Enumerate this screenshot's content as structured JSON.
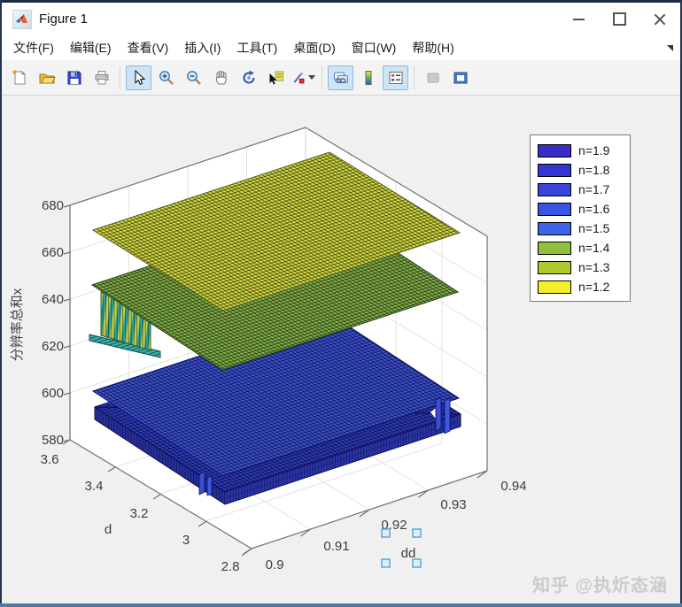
{
  "window": {
    "title": "Figure 1",
    "controls": {
      "minimize": "minimize",
      "maximize": "maximize",
      "close": "close"
    }
  },
  "menu": {
    "items": [
      "文件(F)",
      "编辑(E)",
      "查看(V)",
      "插入(I)",
      "工具(T)",
      "桌面(D)",
      "窗口(W)",
      "帮助(H)"
    ]
  },
  "toolbar": {
    "icons": [
      "new-figure",
      "open-file",
      "save-figure",
      "print-figure",
      "edit-arrow",
      "zoom-in",
      "zoom-out",
      "pan",
      "rotate-3d",
      "data-cursor",
      "brush",
      "link-plot",
      "insert-colorbar",
      "insert-legend",
      "hide-plot-tools",
      "show-plot-tools-dock"
    ],
    "pressed": [
      "edit-arrow",
      "link-plot",
      "insert-legend"
    ],
    "disabled": [
      "hide-plot-tools"
    ]
  },
  "plot": {
    "zlabel": "分辨率总和x",
    "ylabel": "d",
    "xlabel": "dd",
    "z_ticks": [
      "580",
      "600",
      "620",
      "640",
      "660",
      "680"
    ],
    "d_ticks": [
      "3.6",
      "3.4",
      "3.2",
      "3",
      "2.8"
    ],
    "dd_ticks": [
      "0.9",
      "0.91",
      "0.92",
      "0.93",
      "0.94"
    ]
  },
  "legend": {
    "items": [
      {
        "label": "n=1.9",
        "color": "#3a2dc6"
      },
      {
        "label": "n=1.8",
        "color": "#3436d0"
      },
      {
        "label": "n=1.7",
        "color": "#3745d9"
      },
      {
        "label": "n=1.6",
        "color": "#3953e2"
      },
      {
        "label": "n=1.5",
        "color": "#3c63e9"
      },
      {
        "label": "n=1.4",
        "color": "#8fc13d"
      },
      {
        "label": "n=1.3",
        "color": "#adca33"
      },
      {
        "label": "n=1.2",
        "color": "#f4f12b"
      }
    ]
  },
  "watermark": "知乎 @执炘态涵",
  "chart_data": {
    "type": "surface",
    "title": "",
    "xlabel": "dd",
    "ylabel": "d",
    "zlabel": "分辨率总和x",
    "x_range": [
      0.9,
      0.94
    ],
    "y_range": [
      2.8,
      3.6
    ],
    "zlim": [
      580,
      680
    ],
    "grid": true,
    "legend_position": "upper-right",
    "series": [
      {
        "name": "n=1.2",
        "color": "#f4f12b",
        "z_approx": 675,
        "shape": "flat plane"
      },
      {
        "name": "n=1.3",
        "color": "#adca33",
        "z_approx": 650,
        "shape": "flat plane"
      },
      {
        "name": "n=1.4",
        "color": "#8fc13d",
        "z_approx": 648,
        "shape": "flat plane dropping to ~622 near dd=0.90 (striped cliff and teal shelf)"
      },
      {
        "name": "n=1.5",
        "color": "#3c63e9",
        "z_approx": 602,
        "shape": "flat plane"
      },
      {
        "name": "n=1.6",
        "color": "#3953e2",
        "z_approx": 594,
        "shape": "flat plane (top of lower slab)"
      },
      {
        "name": "n=1.7",
        "color": "#3745d9",
        "z_approx": 591,
        "shape": "flat plane with small spikes near dd=0.935 and d=3.15"
      },
      {
        "name": "n=1.8",
        "color": "#3436d0",
        "z_approx": 589,
        "shape": "flat plane"
      },
      {
        "name": "n=1.9",
        "color": "#3a2dc6",
        "z_approx": 587,
        "shape": "flat plane (bottom of lower slab)"
      }
    ]
  }
}
